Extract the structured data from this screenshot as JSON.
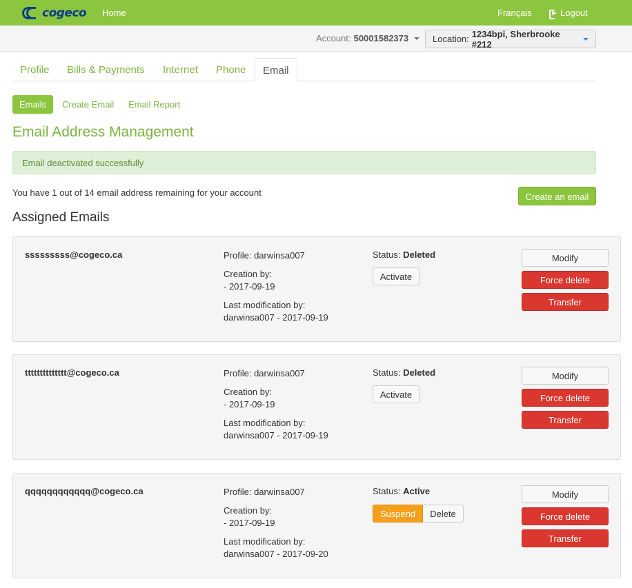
{
  "topbar": {
    "logo_text": "cogeco",
    "home": "Home",
    "language": "Français",
    "logout": "Logout"
  },
  "account_bar": {
    "account_label": "Account:",
    "account_number": "50001582373",
    "location_label": "Location:",
    "location_value": "1234bpi, Sherbrooke #212"
  },
  "tabs": [
    {
      "label": "Profile"
    },
    {
      "label": "Bills & Payments"
    },
    {
      "label": "Internet"
    },
    {
      "label": "Phone"
    },
    {
      "label": "Email",
      "active": true
    }
  ],
  "subnav": {
    "emails": "Emails",
    "create_email": "Create Email",
    "email_report": "Email Report"
  },
  "page_title": "Email Address Management",
  "alert": "Email deactivated successfully",
  "remaining_text": "You have 1 out of 14 email address remaining for your account",
  "create_button": "Create an email",
  "assigned_heading": "Assigned Emails",
  "emails": [
    {
      "address": "sssssssss@cogeco.ca",
      "profile": "Profile: darwinsa007",
      "creation_label": "Creation by:",
      "creation_value": "- 2017-09-19",
      "modification_label": "Last modification by:",
      "modification_value": "darwinsa007 - 2017-09-19",
      "status_label": "Status:",
      "status_value": "Deleted",
      "activate": "Activate",
      "modify": "Modify",
      "force_delete": "Force delete",
      "transfer": "Transfer"
    },
    {
      "address": "tttttttttttttt@cogeco.ca",
      "profile": "Profile: darwinsa007",
      "creation_label": "Creation by:",
      "creation_value": "- 2017-09-19",
      "modification_label": "Last modification by:",
      "modification_value": "darwinsa007 - 2017-09-19",
      "status_label": "Status:",
      "status_value": "Deleted",
      "activate": "Activate",
      "modify": "Modify",
      "force_delete": "Force delete",
      "transfer": "Transfer"
    },
    {
      "address": "qqqqqqqqqqqq@cogeco.ca",
      "profile": "Profile: darwinsa007",
      "creation_label": "Creation by:",
      "creation_value": "- 2017-09-19",
      "modification_label": "Last modification by:",
      "modification_value": "darwinsa007 - 2017-09-20",
      "status_label": "Status:",
      "status_value": "Active",
      "suspend": "Suspend",
      "delete": "Delete",
      "modify": "Modify",
      "force_delete": "Force delete",
      "transfer": "Transfer"
    }
  ],
  "colors": {
    "brand_green": "#8cc63f",
    "link_green": "#7cb342",
    "danger_red": "#d9372f",
    "warning_orange": "#f5a01a",
    "logo_blue": "#0b3f8a"
  },
  "icons": [
    "cogeco-logo",
    "logout-icon",
    "caret-down-icon"
  ]
}
